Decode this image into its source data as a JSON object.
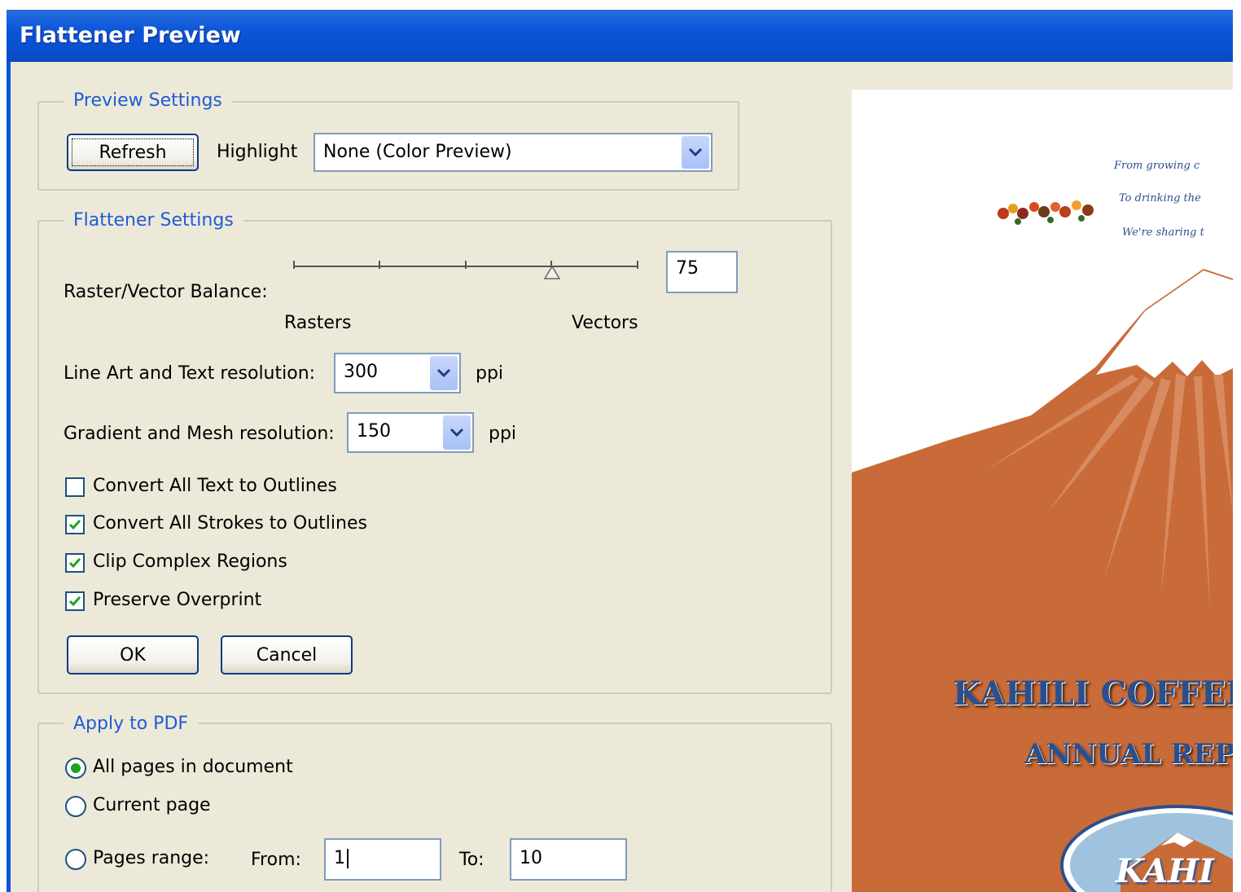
{
  "window": {
    "title": "Flattener Preview"
  },
  "preview_settings": {
    "legend": "Preview Settings",
    "refresh_label": "Refresh",
    "highlight_label": "Highlight",
    "highlight_value": "None (Color Preview)"
  },
  "flattener_settings": {
    "legend": "Flattener Settings",
    "balance_label": "Raster/Vector Balance:",
    "balance_value": "75",
    "balance_fraction": 0.75,
    "rasters_label": "Rasters",
    "vectors_label": "Vectors",
    "line_art_label": "Line Art and Text resolution:",
    "line_art_value": "300",
    "line_art_unit": "ppi",
    "gradient_label": "Gradient and Mesh resolution:",
    "gradient_value": "150",
    "gradient_unit": "ppi",
    "checkboxes": [
      {
        "label": "Convert All Text to Outlines",
        "checked": false
      },
      {
        "label": "Convert All Strokes to Outlines",
        "checked": true
      },
      {
        "label": "Clip Complex Regions",
        "checked": true
      },
      {
        "label": "Preserve Overprint",
        "checked": true
      }
    ],
    "ok_label": "OK",
    "cancel_label": "Cancel"
  },
  "apply_to_pdf": {
    "legend": "Apply to PDF",
    "options": [
      {
        "label": "All pages in document",
        "selected": true
      },
      {
        "label": "Current page",
        "selected": false
      },
      {
        "label": "Pages range:",
        "selected": false
      }
    ],
    "from_label": "From:",
    "from_value": "1",
    "to_label": "To:",
    "to_value": "10"
  },
  "preview": {
    "script_lines": [
      "From growing c",
      "To drinking the",
      "We're sharing t"
    ],
    "company_name": "KAHILI COFFEE",
    "report_title": "ANNUAL REP",
    "logo_text": "KAHI",
    "colors": {
      "mountain": "#c96b38",
      "mountain_light": "#d88a60",
      "snow": "#ffffff",
      "title": "#2a4f8e",
      "logo_ring": "#9fc3de"
    }
  },
  "colors": {
    "titlebar": "#0b55d8",
    "dialog_bg": "#ece9d8",
    "legend_text": "#1f5bd8",
    "check_mark": "#21a121"
  }
}
